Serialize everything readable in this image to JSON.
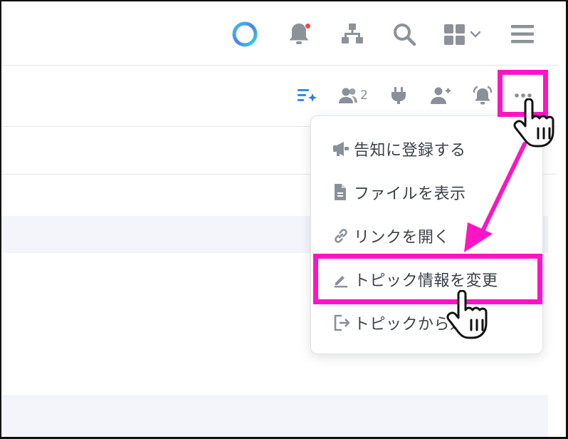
{
  "topbar": {
    "icons": [
      "loading-ring-icon",
      "bell-icon",
      "org-tree-icon",
      "search-icon",
      "apps-grid-icon",
      "hamburger-menu-icon"
    ],
    "notification_dot_color": "#f04848"
  },
  "subbar": {
    "icons": [
      "ai-summary-icon",
      "members-icon",
      "plug-icon",
      "add-member-icon",
      "alarm-bell-icon",
      "more-icon"
    ],
    "member_count": "2"
  },
  "menu": {
    "items": [
      {
        "label": "告知に登録する",
        "icon": "megaphone-icon"
      },
      {
        "label": "ファイルを表示",
        "icon": "file-icon"
      },
      {
        "label": "リンクを開く",
        "icon": "link-icon"
      },
      {
        "label": "トピック情報を変更",
        "icon": "pencil-icon"
      },
      {
        "label": "トピックから退出",
        "icon": "exit-icon"
      }
    ]
  },
  "annotation": {
    "highlight_color": "#ff14c4"
  }
}
